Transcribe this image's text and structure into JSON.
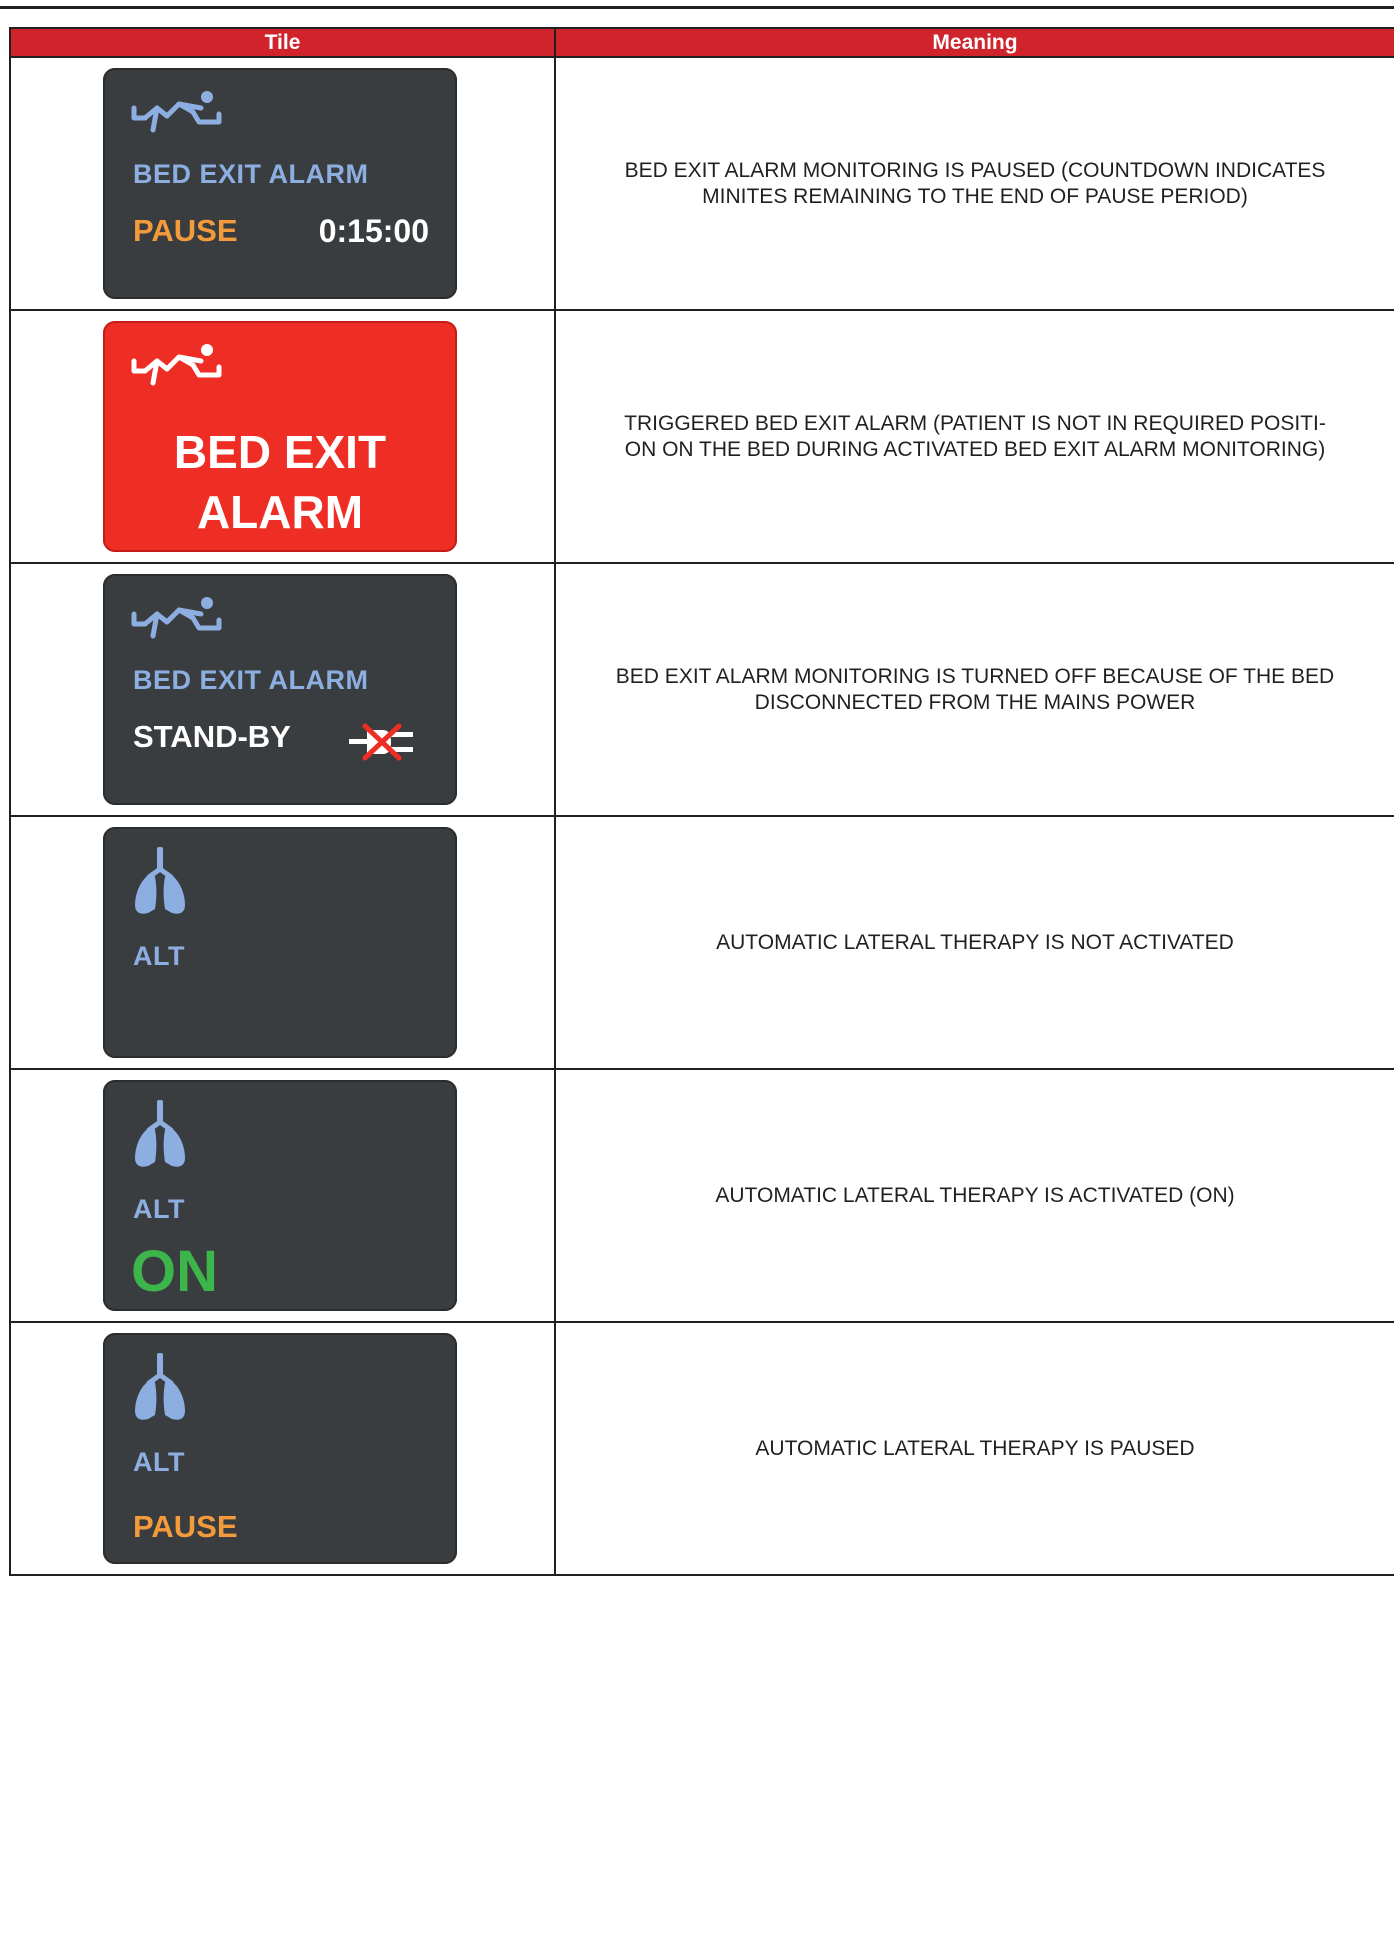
{
  "table": {
    "headers": {
      "tile": "Tile",
      "meaning": "Meaning"
    },
    "rows": [
      {
        "tile": {
          "label": "BED EXIT ALARM",
          "status": "PAUSE",
          "timer": "0:15:00",
          "icon": "bed-exit-person-icon"
        },
        "meaning": [
          "BED EXIT ALARM MONITORING IS PAUSED (COUNTDOWN INDICATES",
          "MINITES REMAINING TO THE END OF PAUSE PERIOD)"
        ]
      },
      {
        "tile": {
          "line1": "BED EXIT",
          "line2": "ALARM",
          "icon": "bed-exit-person-icon"
        },
        "meaning": [
          "TRIGGERED BED EXIT ALARM (PATIENT IS NOT IN REQUIRED POSITI-",
          "ON ON THE BED DURING ACTIVATED BED EXIT ALARM MONITORING)"
        ]
      },
      {
        "tile": {
          "label": "BED EXIT ALARM",
          "status": "STAND-BY",
          "icon": "bed-exit-person-icon",
          "status_icon": "unplugged-icon"
        },
        "meaning": [
          "BED EXIT ALARM MONITORING IS TURNED OFF BECAUSE OF THE BED",
          "DISCONNECTED FROM THE MAINS POWER"
        ]
      },
      {
        "tile": {
          "label": "ALT",
          "icon": "lungs-icon"
        },
        "meaning": [
          "AUTOMATIC LATERAL THERAPY IS NOT ACTIVATED"
        ]
      },
      {
        "tile": {
          "label": "ALT",
          "status": "ON",
          "icon": "lungs-icon"
        },
        "meaning": [
          "AUTOMATIC LATERAL THERAPY IS ACTIVATED (ON)"
        ]
      },
      {
        "tile": {
          "label": "ALT",
          "status": "PAUSE",
          "icon": "lungs-icon"
        },
        "meaning": [
          "AUTOMATIC LATERAL THERAPY IS PAUSED"
        ]
      }
    ]
  },
  "colors": {
    "header_bg": "#d0232b",
    "tile_bg": "#3a3d40",
    "tile_alarm_bg": "#ee2d24",
    "label_blue": "#8daee0",
    "pause_orange": "#f39b3b",
    "on_green": "#3cb54a",
    "white": "#ffffff"
  }
}
